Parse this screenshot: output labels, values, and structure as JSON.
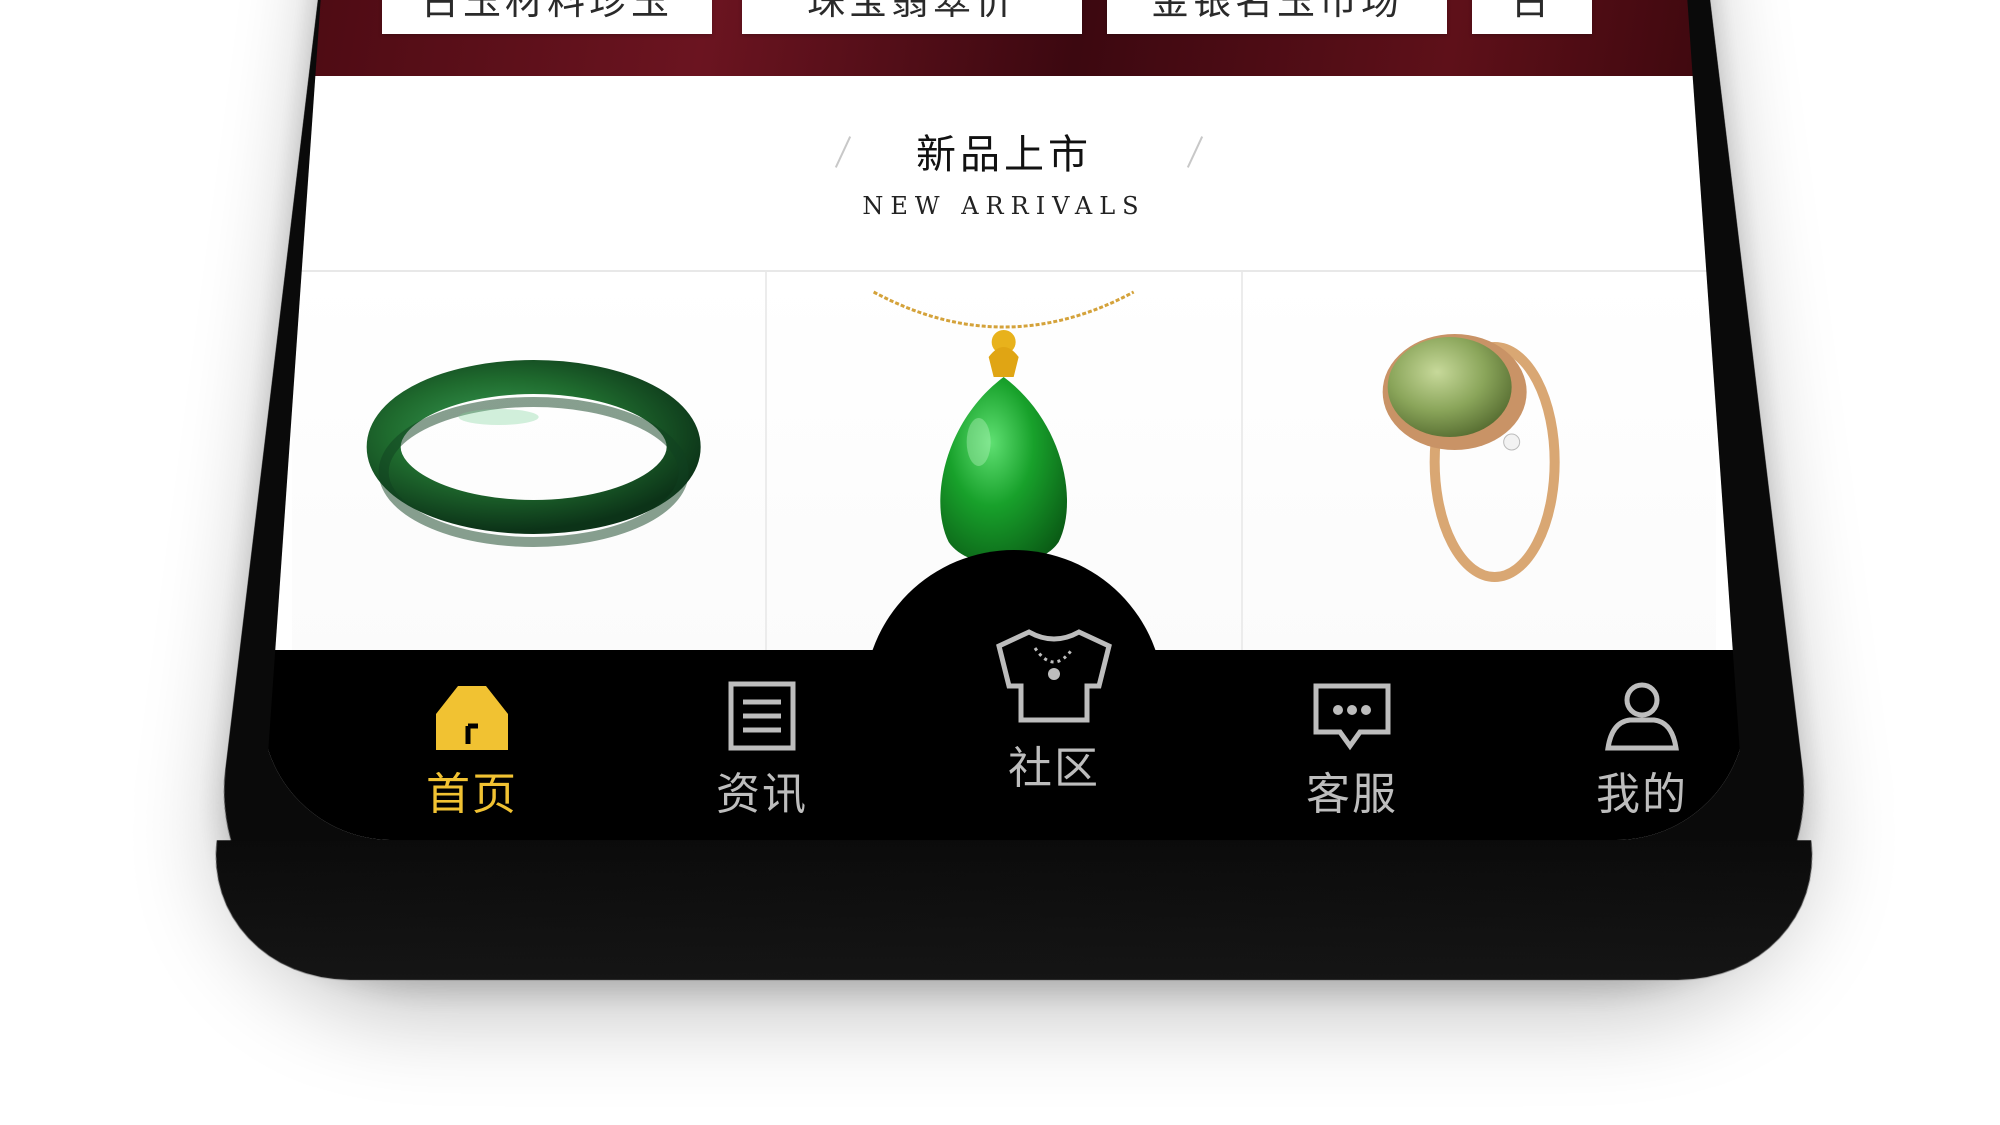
{
  "banner": {
    "cards": [
      "古玉材料珍玉",
      "珠宝翡翠价",
      "金银名玉市场",
      "古"
    ]
  },
  "section": {
    "title": "新品上市",
    "subtitle": "NEW ARRIVALS"
  },
  "products": [
    {
      "name": "jade-bangle",
      "color": "#1f6b2e"
    },
    {
      "name": "jade-pendant",
      "color": "#1a9b2c"
    },
    {
      "name": "jade-ring",
      "color": "#8aa55a"
    }
  ],
  "tabbar": {
    "items": [
      {
        "label": "首页",
        "icon": "home-icon",
        "active": true
      },
      {
        "label": "资讯",
        "icon": "news-icon",
        "active": false
      },
      {
        "label": "社区",
        "icon": "community-icon",
        "active": false
      },
      {
        "label": "客服",
        "icon": "chat-icon",
        "active": false
      },
      {
        "label": "我的",
        "icon": "profile-icon",
        "active": false
      }
    ]
  },
  "colors": {
    "accent": "#f1c232",
    "tabbar_bg": "#000000",
    "inactive": "#bdbdbd",
    "banner": "#5e1019"
  }
}
